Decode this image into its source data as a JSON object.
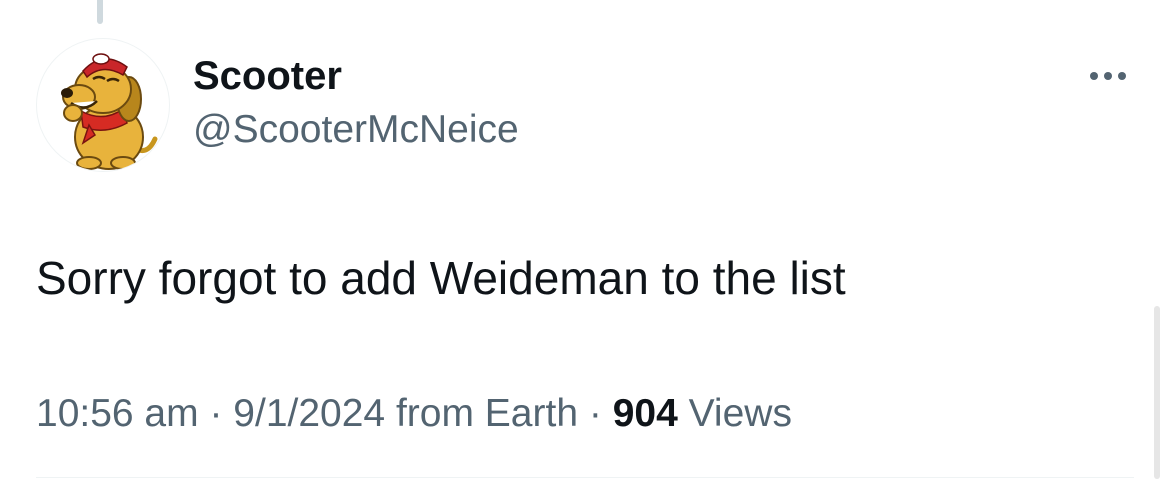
{
  "tweet": {
    "author": {
      "display_name": "Scooter",
      "handle": "@ScooterMcNeice",
      "avatar_icon": "cartoon-dog-avatar-icon"
    },
    "text": "Sorry forgot to add Weideman to the list",
    "time": "10:56 am",
    "separator": "·",
    "date": "9/1/2024",
    "source": "from Earth",
    "views_count": "904",
    "views_label": "Views",
    "more_icon": "more-options-icon"
  },
  "colors": {
    "text_primary": "#0f1419",
    "text_secondary": "#536471",
    "border": "#eff3f4",
    "thread_line": "#cfd9de"
  }
}
